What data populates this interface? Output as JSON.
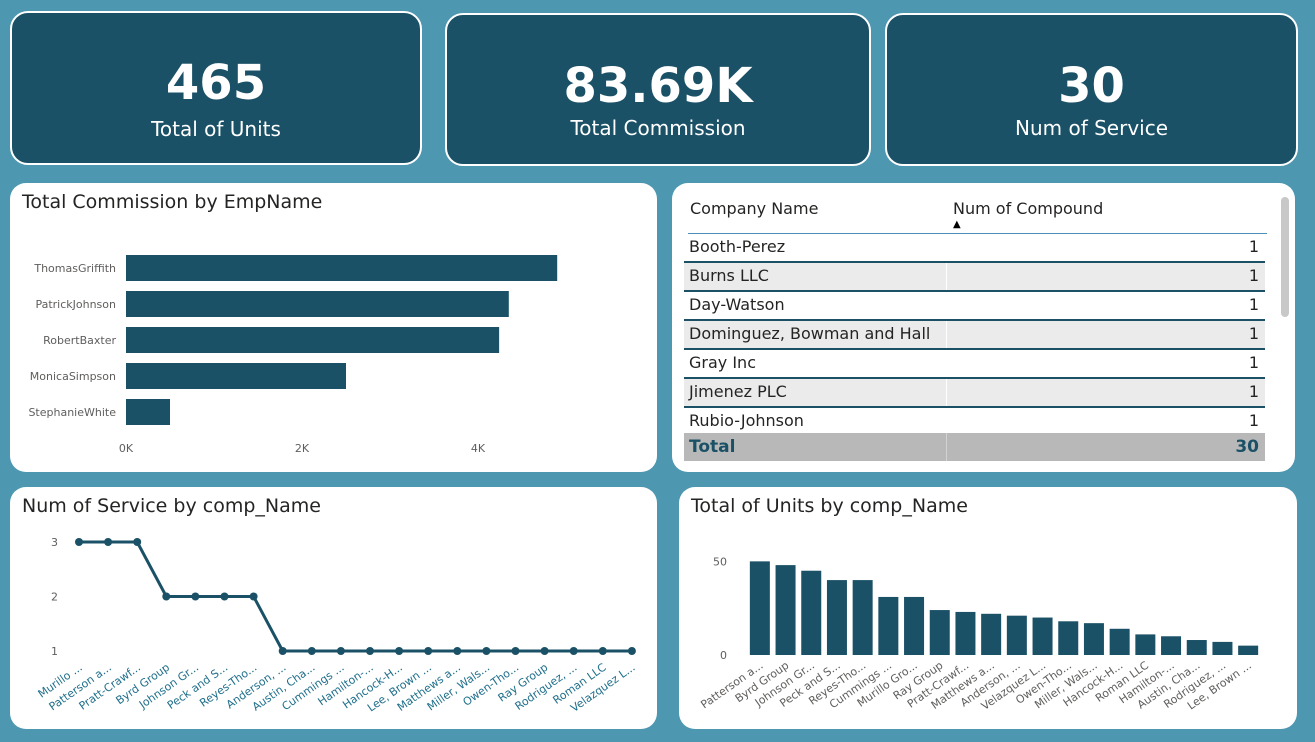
{
  "kpis": [
    {
      "value": "465",
      "label": "Total of Units"
    },
    {
      "value": "83.69K",
      "label": "Total Commission"
    },
    {
      "value": "30",
      "label": "Num of Service"
    }
  ],
  "commission_chart": {
    "title": "Total Commission by EmpName"
  },
  "table": {
    "col1": "Company Name",
    "col2": "Num of Compound",
    "rows": [
      {
        "name": "Booth-Perez",
        "value": "1"
      },
      {
        "name": "Burns LLC",
        "value": "1"
      },
      {
        "name": "Day-Watson",
        "value": "1"
      },
      {
        "name": "Dominguez, Bowman and Hall",
        "value": "1"
      },
      {
        "name": "Gray Inc",
        "value": "1"
      },
      {
        "name": "Jimenez PLC",
        "value": "1"
      },
      {
        "name": "Rubio-Johnson",
        "value": "1"
      }
    ],
    "total_label": "Total",
    "total_value": "30"
  },
  "service_chart": {
    "title": "Num of Service by comp_Name"
  },
  "units_chart": {
    "title": "Total of Units by comp_Name"
  },
  "colors": {
    "bar": "#1a5166",
    "background": "#4e97b0",
    "axis_text": "#605e5c",
    "xlabel_text": "#1f6f8b"
  },
  "chart_data": [
    {
      "type": "bar",
      "orientation": "horizontal",
      "title": "Total Commission by EmpName",
      "categories": [
        "ThomasGriffith",
        "PatrickJohnson",
        "RobertBaxter",
        "MonicaSimpson",
        "StephanieWhite"
      ],
      "values": [
        4900,
        4350,
        4240,
        2500,
        500
      ],
      "xlim": [
        0,
        5500
      ],
      "xticks": [
        0,
        2000,
        4000
      ],
      "xtick_labels": [
        "0K",
        "2K",
        "4K"
      ],
      "grid": false
    },
    {
      "type": "line",
      "title": "Num of Service by comp_Name",
      "categories": [
        "Murillo ...",
        "Patterson a...",
        "Pratt-Crawf...",
        "Byrd Group",
        "Johnson Gr...",
        "Peck and S...",
        "Reyes-Tho...",
        "Anderson, ...",
        "Austin, Cha...",
        "Cummings ...",
        "Hamilton-...",
        "Hancock-H...",
        "Lee, Brown ...",
        "Matthews a...",
        "Miller, Wals...",
        "Owen-Tho...",
        "Ray Group",
        "Rodriguez, ...",
        "Roman LLC",
        "Velazquez L..."
      ],
      "values": [
        3,
        3,
        3,
        2,
        2,
        2,
        2,
        1,
        1,
        1,
        1,
        1,
        1,
        1,
        1,
        1,
        1,
        1,
        1,
        1
      ],
      "yticks": [
        1,
        2,
        3
      ],
      "ylim": [
        1,
        3
      ],
      "markers": true,
      "grid": false
    },
    {
      "type": "bar",
      "title": "Total of Units by comp_Name",
      "categories": [
        "Patterson a...",
        "Byrd Group",
        "Johnson Gr...",
        "Peck and S...",
        "Reyes-Tho...",
        "Cummings ...",
        "Murillo Gro...",
        "Ray Group",
        "Pratt-Crawf...",
        "Matthews a...",
        "Anderson, ...",
        "Velazquez L...",
        "Owen-Tho...",
        "Miller, Wals...",
        "Hancock-H...",
        "Roman LLC",
        "Hamilton-...",
        "Austin, Cha...",
        "Rodriguez, ...",
        "Lee, Brown ..."
      ],
      "values": [
        50,
        48,
        45,
        40,
        40,
        31,
        31,
        24,
        23,
        22,
        21,
        20,
        18,
        17,
        14,
        11,
        10,
        8,
        7,
        5
      ],
      "yticks": [
        0,
        50
      ],
      "ylim": [
        0,
        55
      ],
      "grid": false
    }
  ]
}
